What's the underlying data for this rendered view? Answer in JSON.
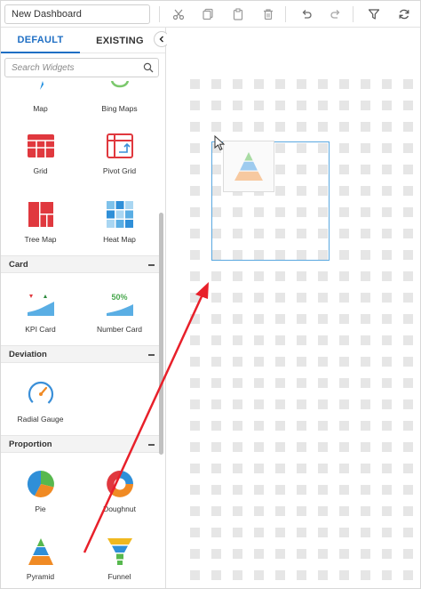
{
  "toolbar": {
    "dashboard_name": "New Dashboard",
    "buttons": [
      "cut-icon",
      "copy-icon",
      "paste-icon",
      "delete-icon",
      "undo-icon",
      "redo-icon",
      "filter-icon",
      "refresh-icon"
    ]
  },
  "panel": {
    "tabs": {
      "default": "DEFAULT",
      "existing": "EXISTING"
    },
    "search_placeholder": "Search Widgets",
    "widgets_top": [
      {
        "label": "Map",
        "icon": "map-icon"
      },
      {
        "label": "Bing Maps",
        "icon": "bing-maps-icon"
      },
      {
        "label": "Grid",
        "icon": "grid-icon"
      },
      {
        "label": "Pivot Grid",
        "icon": "pivot-grid-icon"
      },
      {
        "label": "Tree Map",
        "icon": "tree-map-icon"
      },
      {
        "label": "Heat Map",
        "icon": "heat-map-icon"
      }
    ],
    "sections": [
      {
        "title": "Card",
        "widgets": [
          {
            "label": "KPI Card"
          },
          {
            "label": "Number Card",
            "value": "50%"
          }
        ]
      },
      {
        "title": "Deviation",
        "widgets": [
          {
            "label": "Radial Gauge"
          }
        ]
      },
      {
        "title": "Proportion",
        "widgets": [
          {
            "label": "Pie"
          },
          {
            "label": "Doughnut"
          },
          {
            "label": "Pyramid"
          },
          {
            "label": "Funnel"
          }
        ]
      }
    ]
  },
  "colors": {
    "accent": "#1f6fc4",
    "grid_red": "#e0383e",
    "selection": "#5aa8e0",
    "arrow": "#e8202a"
  }
}
